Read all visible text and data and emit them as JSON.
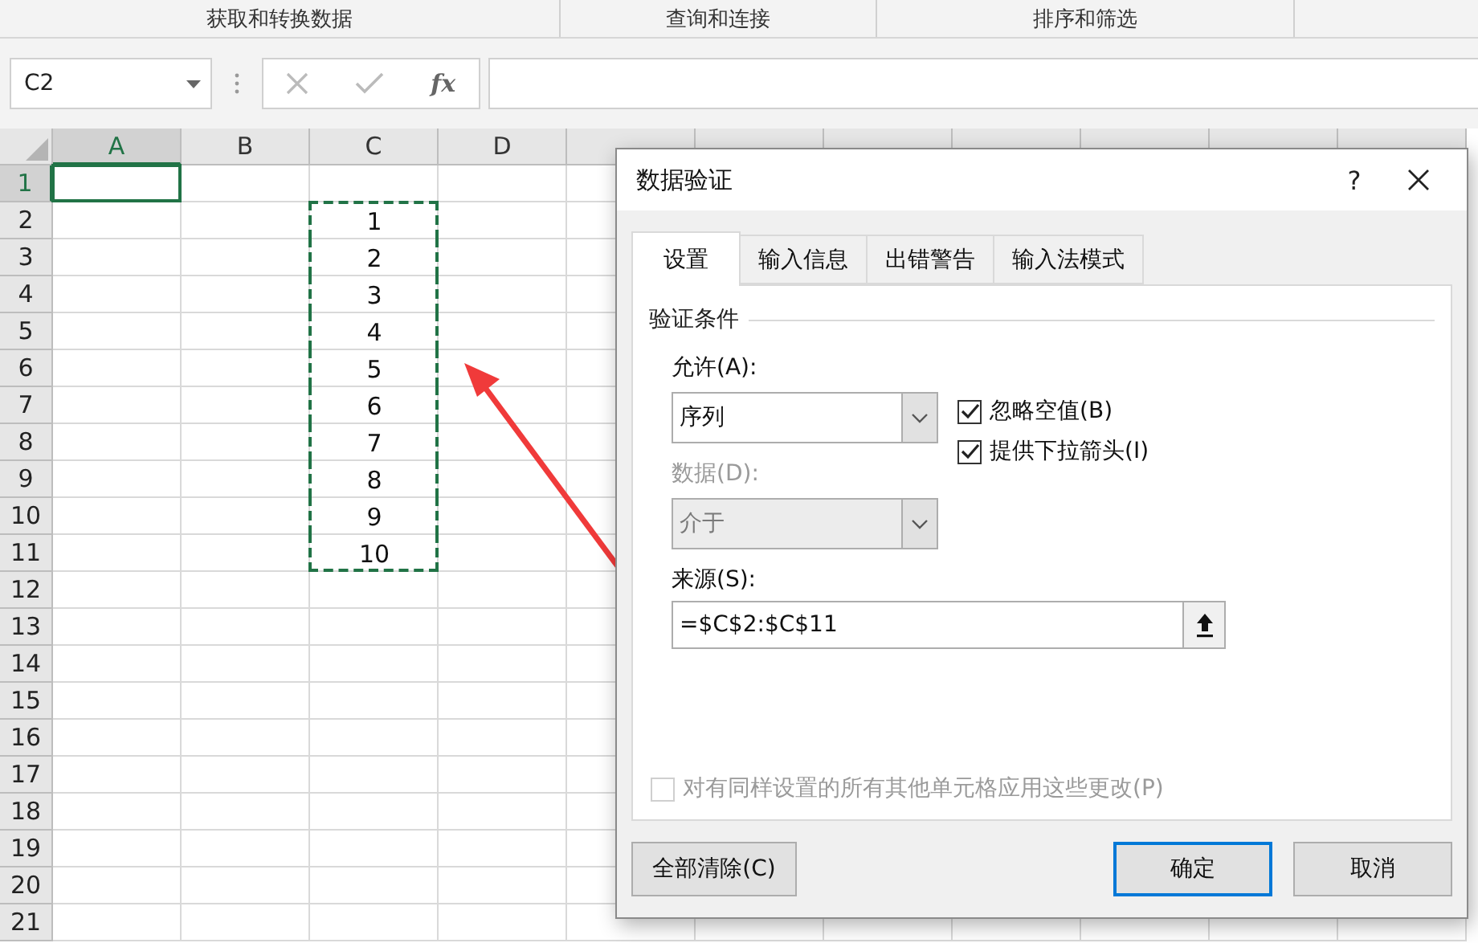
{
  "ribbon_groups": [
    {
      "label": "获取和转换数据"
    },
    {
      "label": "查询和连接"
    },
    {
      "label": "排序和筛选"
    }
  ],
  "formula_bar": {
    "name_box": "C2",
    "function_label": "fx"
  },
  "sheet": {
    "columns": [
      {
        "label": "A",
        "selected": true
      },
      {
        "label": "B",
        "selected": false
      },
      {
        "label": "C",
        "selected": false
      },
      {
        "label": "D",
        "selected": false
      }
    ],
    "rows": [
      {
        "label": "1",
        "selected": true,
        "copied": false
      },
      {
        "label": "2",
        "selected": false,
        "copied": true,
        "column_c": "1"
      },
      {
        "label": "3",
        "selected": false,
        "copied": true,
        "column_c": "2"
      },
      {
        "label": "4",
        "selected": false,
        "copied": true,
        "column_c": "3"
      },
      {
        "label": "5",
        "selected": false,
        "copied": true,
        "column_c": "4"
      },
      {
        "label": "6",
        "selected": false,
        "copied": true,
        "column_c": "5"
      },
      {
        "label": "7",
        "selected": false,
        "copied": true,
        "column_c": "6"
      },
      {
        "label": "8",
        "selected": false,
        "copied": true,
        "column_c": "7"
      },
      {
        "label": "9",
        "selected": false,
        "copied": true,
        "column_c": "8"
      },
      {
        "label": "10",
        "selected": false,
        "copied": true,
        "column_c": "9"
      },
      {
        "label": "11",
        "selected": false,
        "copied": true,
        "column_c": "10"
      },
      {
        "label": "12",
        "selected": false,
        "copied": false
      },
      {
        "label": "13",
        "selected": false,
        "copied": false
      },
      {
        "label": "14",
        "selected": false,
        "copied": false
      },
      {
        "label": "15",
        "selected": false,
        "copied": false
      },
      {
        "label": "16",
        "selected": false,
        "copied": false
      },
      {
        "label": "17",
        "selected": false,
        "copied": false
      },
      {
        "label": "18",
        "selected": false,
        "copied": false
      },
      {
        "label": "19",
        "selected": false,
        "copied": false
      },
      {
        "label": "20",
        "selected": false,
        "copied": false
      },
      {
        "label": "21",
        "selected": false,
        "copied": false
      }
    ]
  },
  "dialog": {
    "title": "数据验证",
    "help": "?",
    "tabs": [
      {
        "label": "设置",
        "selected": true
      },
      {
        "label": "输入信息",
        "selected": false
      },
      {
        "label": "出错警告",
        "selected": false
      },
      {
        "label": "输入法模式",
        "selected": false
      }
    ],
    "group_title": "验证条件",
    "allow": {
      "label": "允许(A):",
      "value": "序列",
      "disabled": false
    },
    "options": [
      {
        "label": "忽略空值(B)",
        "checked": true
      },
      {
        "label": "提供下拉箭头(I)",
        "checked": true
      }
    ],
    "data": {
      "label": "数据(D):",
      "value": "介于",
      "disabled": true
    },
    "source": {
      "label": "来源(S):",
      "value": "=$C$2:$C$11"
    },
    "apply_all": {
      "label": "对有同样设置的所有其他单元格应用这些更改(P)",
      "checked": false,
      "disabled": true
    },
    "buttons": [
      {
        "label": "全部清除(C)",
        "kind": "left",
        "default": false
      },
      {
        "label": "确定",
        "kind": "right",
        "default": true
      },
      {
        "label": "取消",
        "kind": "right",
        "default": false
      }
    ]
  }
}
